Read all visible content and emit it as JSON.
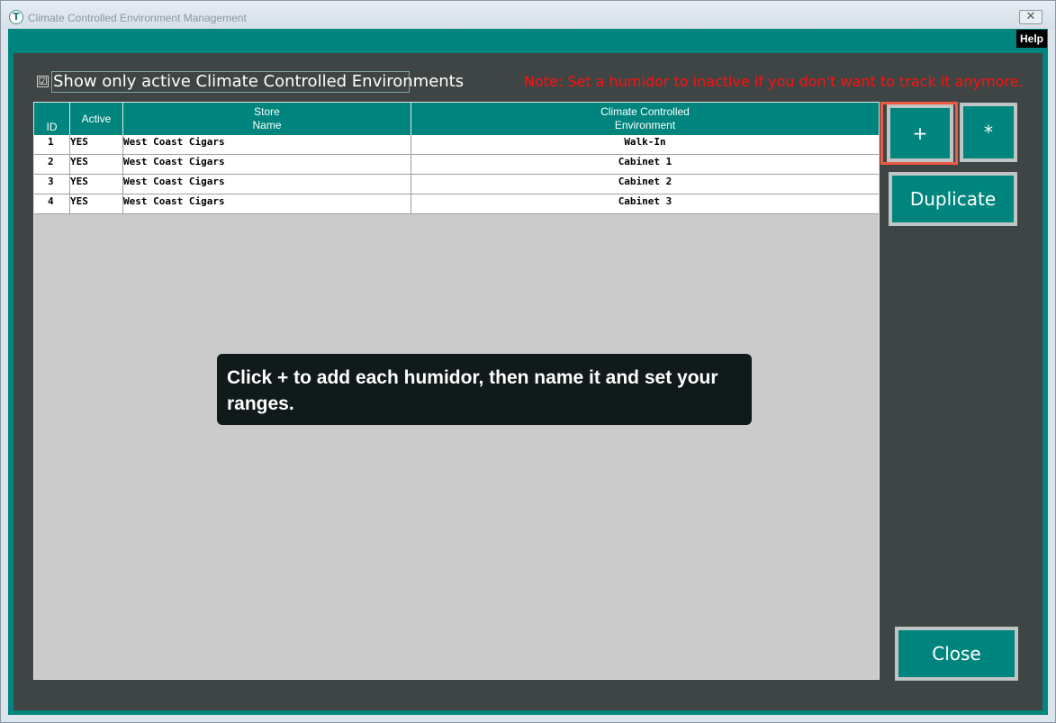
{
  "window": {
    "icon_letter": "T",
    "title": "Climate Controlled Environment Management",
    "close_glyph": "✕",
    "help_label": "Help"
  },
  "filter": {
    "checked_glyph": "☑",
    "label": "Show only active Climate Controlled Environments"
  },
  "note": "Note: Set a humidor to inactive if you don't want to track it anymore.",
  "table": {
    "headers": {
      "id": "ID",
      "active": "Active",
      "store_line1": "Store",
      "store_line2": "Name",
      "env_line1": "Climate Controlled",
      "env_line2": "Environment"
    },
    "rows": [
      {
        "id": "1",
        "active": "YES",
        "store": "West Coast Cigars",
        "env": "Walk-In"
      },
      {
        "id": "2",
        "active": "YES",
        "store": "West Coast Cigars",
        "env": "Cabinet 1"
      },
      {
        "id": "3",
        "active": "YES",
        "store": "West Coast Cigars",
        "env": "Cabinet 2"
      },
      {
        "id": "4",
        "active": "YES",
        "store": "West Coast Cigars",
        "env": "Cabinet 3"
      }
    ]
  },
  "buttons": {
    "add": "+",
    "star": "*",
    "duplicate": "Duplicate",
    "close": "Close"
  },
  "tooltip": "Click + to add each humidor, then name it and set your ranges.",
  "colors": {
    "teal": "#00857e",
    "panel": "#3f4544",
    "note_red": "#ff1010",
    "highlight": "#ef5a43"
  }
}
